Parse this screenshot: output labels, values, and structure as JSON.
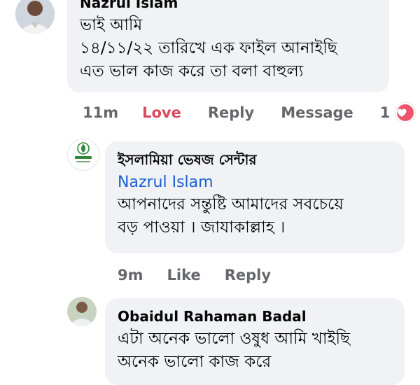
{
  "comments": [
    {
      "author": "Nazrul Islam",
      "lines": [
        "ভাই আমি",
        "১৪/১১/২২ তারিখে এক ফাইল আনাইছি",
        "এত ভাল কাজ করে তা বলা বাহুল্য"
      ],
      "time": "11m",
      "reacted_label": "Love",
      "reply_label": "Reply",
      "message_label": "Message",
      "reaction_count": "1",
      "reaction_color": "#f0556e"
    },
    {
      "author": "ইসলামিয়া ভেষজ সেন্টার",
      "tag": "Nazrul Islam",
      "lines": [
        "আপনাদের সন্তুষ্টি আমাদের সবচেয়ে",
        "বড় পাওয়া । জাযাকাল্লাহ ।"
      ],
      "time": "9m",
      "like_label": "Like",
      "reply_label": "Reply"
    },
    {
      "author": "Obaidul Rahaman Badal",
      "lines": [
        "এটা অনেক ভালো ওষুধ আমি খাইছি",
        "অনেক ভালো কাজ করে"
      ]
    }
  ],
  "colors": {
    "bubble": "#f0f2f5",
    "mention": "#1b5fd1",
    "love": "#d94a5e",
    "muted": "#65676b",
    "brand_green": "#2f8a3a"
  },
  "icons": {
    "reaction": "heart-icon",
    "page_logo": "leaf-logo-icon"
  }
}
